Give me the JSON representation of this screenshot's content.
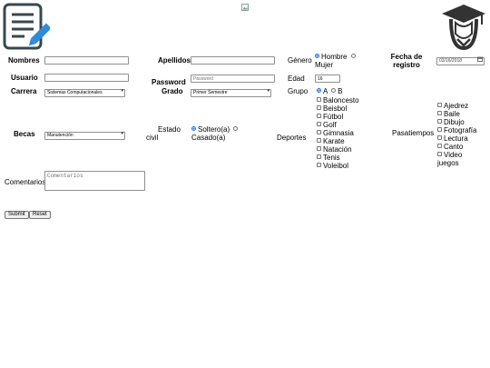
{
  "form": {
    "nombres_label": "Nombres",
    "apellidos_label": "Apellidos",
    "genero_label": "Género",
    "genero_options": [
      "Hombre",
      "Mujer"
    ],
    "fecha_label_1": "Fecha de",
    "fecha_label_2": "registro",
    "fecha_value": "03/16/2018",
    "usuario_label": "Usuario",
    "password_label": "Password",
    "password_placeholder": "Password",
    "edad_label": "Edad",
    "edad_value": "16",
    "carrera_label": "Carrera",
    "carrera_value": "Sistemas Computacionales",
    "grado_label": "Grado",
    "grado_value": "Primer Semestre",
    "grupo_label": "Grupo",
    "grupo_options": [
      "A",
      "B"
    ],
    "becas_label": "Becas",
    "becas_value": "Manutención",
    "estado_label_1": "Estado",
    "estado_label_2": "civil",
    "estado_options": [
      "Soltero(a)",
      "Casado(a)"
    ],
    "deportes_label": "Deportes",
    "deportes": [
      "Baloncesto",
      "Beisbol",
      "Fútbol",
      "Golf",
      "Gimnasia",
      "Karate",
      "Natación",
      "Tenis",
      "Voleibol"
    ],
    "pasatiempos_label": "Pasatiempos",
    "pasatiempos": [
      "Ajedrez",
      "Baile",
      "Dibujo",
      "Fotografía",
      "Lectura",
      "Canto",
      "Video juegos"
    ],
    "comentarios_label": "Comentarios",
    "comentarios_placeholder": "Comentarios",
    "submit_label": "Submit",
    "reset_label": "Reset"
  },
  "icons": {
    "left": "edit-document-icon",
    "center": "broken-image-icon",
    "right": "graduate-icon"
  },
  "colors": {
    "icon_blue": "#2f8bd8",
    "icon_dark": "#333333",
    "radio_checked": "#1a73e8"
  }
}
